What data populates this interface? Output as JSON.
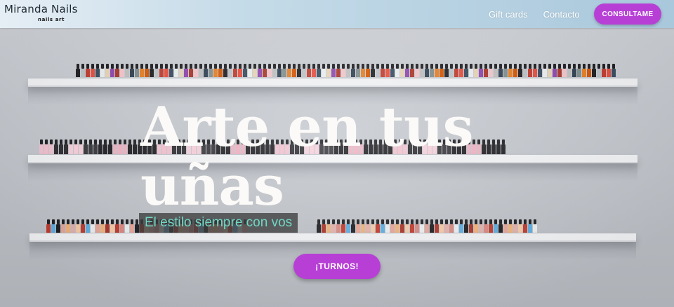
{
  "header": {
    "logo_title": "Miranda Nails",
    "logo_subtitle": "nails art",
    "nav": [
      {
        "label": "Gift cards"
      },
      {
        "label": "Contacto"
      }
    ],
    "cta_label": "CONSULTAME"
  },
  "hero": {
    "headline_line1": "Arte en tus",
    "headline_line2": "uñas",
    "tagline": "El estilo siempre con vos",
    "cta_label": "¡TURNOS!",
    "background": "wall-with-nail-polish-shelves"
  },
  "colors": {
    "accent": "#b73fd6",
    "tagline_text": "#6fd7c6",
    "headline_text": "#fbfaf8"
  }
}
